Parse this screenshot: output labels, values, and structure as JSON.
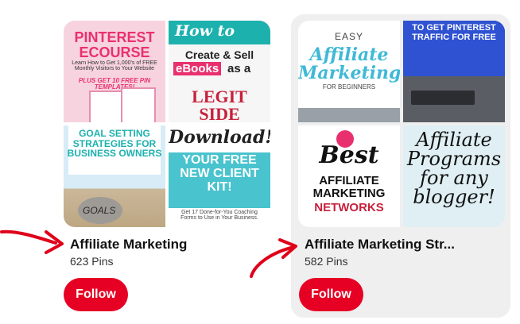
{
  "boards": [
    {
      "title": "Affiliate Marketing",
      "pins": "623 Pins",
      "follow_label": "Follow",
      "tiles": [
        {
          "heading": "PINTEREST ECOURSE",
          "sub": "Learn How to Get 1,000's of FREE Monthly Visitors to Your Website",
          "extra": "PLUS GET 10 FREE PIN TEMPLATES!"
        },
        {
          "heading": "How to",
          "line1": "Create & Sell",
          "line2a": "eBooks",
          "line2b": "as a",
          "line3": "LEGIT",
          "line4": "SIDE HUSTLE"
        },
        {
          "heading": "GOAL SETTING STRATEGIES FOR BUSINESS OWNERS",
          "rock": "GOALS"
        },
        {
          "heading": "Download!",
          "line1": "YOUR FREE NEW CLIENT KIT!",
          "sub": "Get 17 Done-for-You Coaching Forms to Use in Your Business."
        }
      ]
    },
    {
      "title": "Affiliate Marketing Str...",
      "pins": "582 Pins",
      "follow_label": "Follow",
      "tiles": [
        {
          "heading": "EASY",
          "line1": "Affiliate Marketing",
          "sub": "FOR BEGINNERS"
        },
        {
          "heading": "TO GET PINTEREST TRAFFIC FOR FREE"
        },
        {
          "heading": "Best",
          "line1": "AFFILIATE MARKETING",
          "line2": "NETWORKS"
        },
        {
          "heading": "Affiliate Programs for any blogger!"
        }
      ]
    }
  ],
  "colors": {
    "follow": "#e60023",
    "annotation": "#e0001a",
    "selected_bg": "#efefef"
  }
}
